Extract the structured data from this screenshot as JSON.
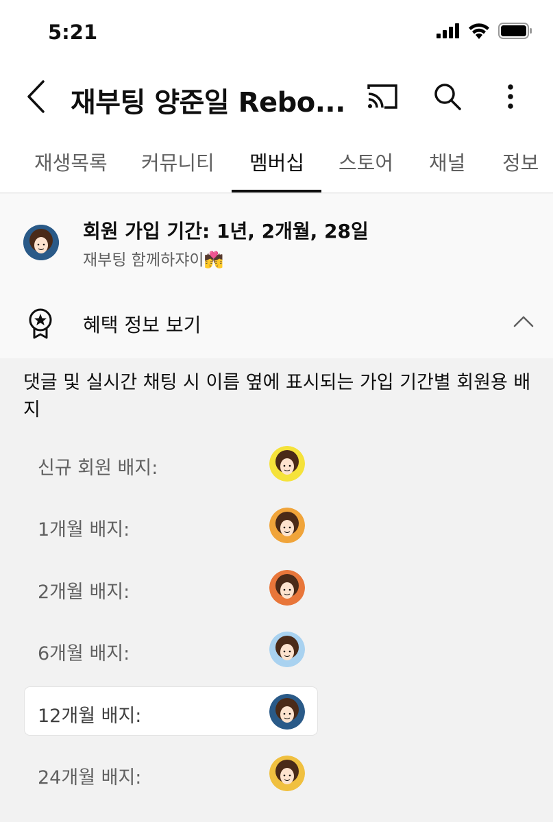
{
  "status": {
    "time": "5:21"
  },
  "header": {
    "title": "재부팅 양준일 Rebo..."
  },
  "tabs": [
    {
      "label": "재생목록"
    },
    {
      "label": "커뮤니티"
    },
    {
      "label": "멤버십"
    },
    {
      "label": "스토어"
    },
    {
      "label": "채널"
    },
    {
      "label": "정보"
    }
  ],
  "membership": {
    "duration": "회원 가입 기간: 1년, 2개월, 28일",
    "tier": "재부팅 함께하쟈이💏"
  },
  "benefits": {
    "label": "혜택 정보 보기"
  },
  "badges": {
    "description": "댓글 및 실시간 채팅 시 이름 옆에 표시되는 가입 기간별 회원용 배지",
    "items": [
      {
        "label": "신규 회원 배지:",
        "color": "#f5e23a"
      },
      {
        "label": "1개월 배지:",
        "color": "#f0a43a"
      },
      {
        "label": "2개월 배지:",
        "color": "#e8763a"
      },
      {
        "label": "6개월 배지:",
        "color": "#a9d2f0"
      },
      {
        "label": "12개월 배지:",
        "color": "#2a5a88"
      },
      {
        "label": "24개월 배지:",
        "color": "#f0c040"
      }
    ]
  },
  "colors": {
    "active_tab": "#0f0f0f",
    "inactive_tab": "#606060"
  }
}
